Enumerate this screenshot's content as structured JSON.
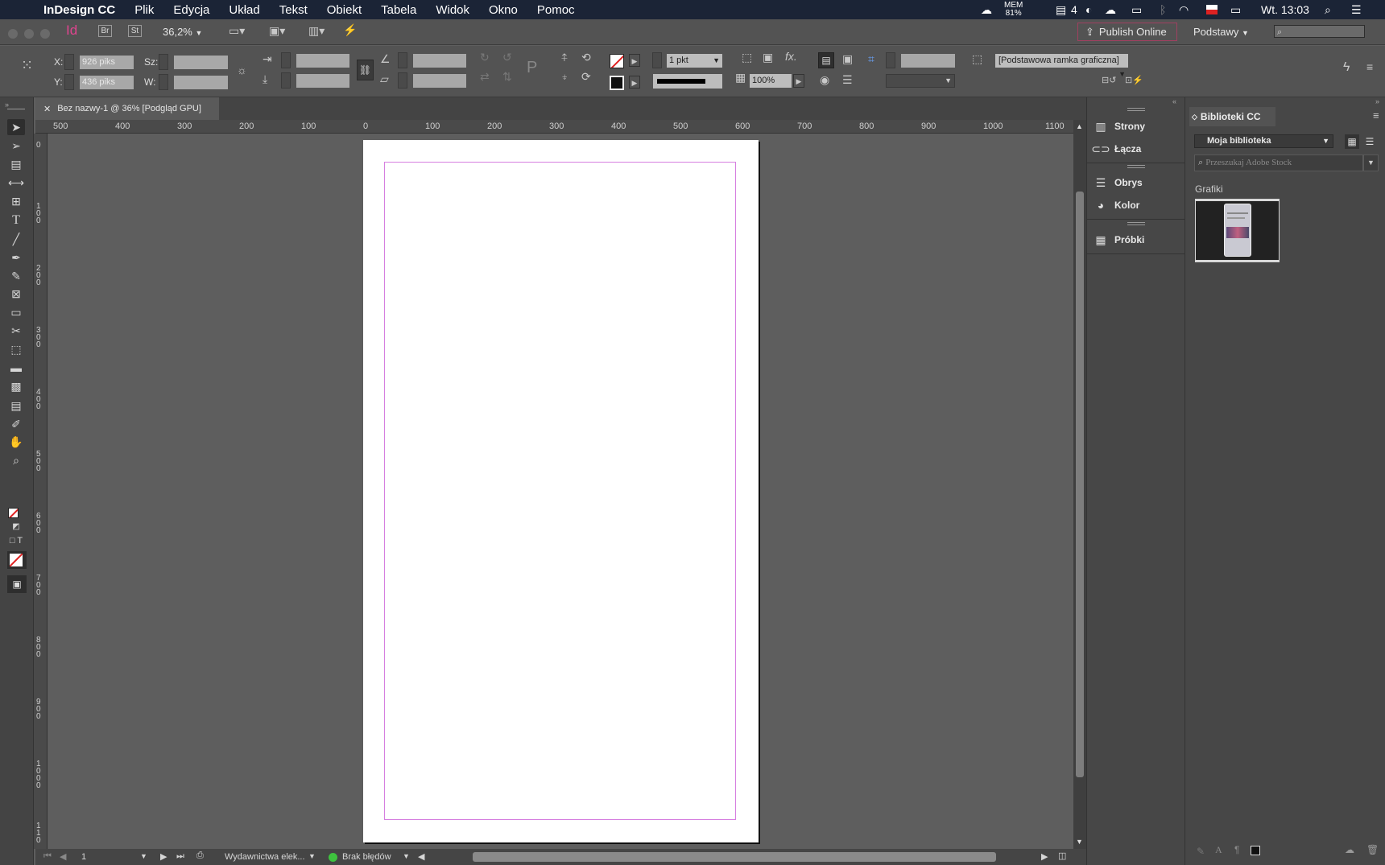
{
  "menubar": {
    "app_name": "InDesign CC",
    "items": [
      "Plik",
      "Edycja",
      "Układ",
      "Tekst",
      "Obiekt",
      "Tabela",
      "Widok",
      "Okno",
      "Pomoc"
    ],
    "mem_label": "MEM",
    "mem_value": "81%",
    "notif_count": "4",
    "clock": "Wt. 13:03"
  },
  "appbar": {
    "app_logo": "Id",
    "bridge": "Br",
    "stock": "St",
    "zoom": "36,2%",
    "publish_online": "Publish Online",
    "workspace": "Podstawy",
    "search_placeholder": ""
  },
  "control": {
    "x_label": "X:",
    "x_value": "926 piks",
    "y_label": "Y:",
    "y_value": "436 piks",
    "w_label": "Sz:",
    "h_label": "W:",
    "stroke_weight": "1 pkt",
    "opacity": "100%",
    "frame_style": "[Podstawowa ramka graficzna]"
  },
  "document": {
    "tab_title": "Bez nazwy-1 @ 36% [Podgląd GPU]"
  },
  "ruler": {
    "h_ticks": [
      "500",
      "400",
      "300",
      "200",
      "100",
      "0",
      "100",
      "200",
      "300",
      "400",
      "500",
      "600",
      "700",
      "800",
      "900",
      "1000",
      "1100"
    ],
    "v_ticks": [
      "0",
      "1\n0\n0",
      "2\n0\n0",
      "3\n0\n0",
      "4\n0\n0",
      "5\n0\n0",
      "6\n0\n0",
      "7\n0\n0",
      "8\n0\n0",
      "9\n0\n0",
      "1\n0\n0\n0",
      "1\n1\n0"
    ]
  },
  "dock": {
    "items": [
      "Strony",
      "Łącza",
      "Obrys",
      "Kolor",
      "Próbki"
    ]
  },
  "libraries": {
    "panel_title": "Biblioteki CC",
    "library_name": "Moja biblioteka",
    "search_placeholder": "Przeszukaj Adobe Stock",
    "section": "Grafiki"
  },
  "status": {
    "page_number": "1",
    "profile": "Wydawnictwa elek...",
    "preflight": "Brak błędów"
  },
  "colors": {
    "accent_pink": "#e0448f",
    "margin_guide": "#d67fe0",
    "preflight_ok": "#3ec23e"
  }
}
